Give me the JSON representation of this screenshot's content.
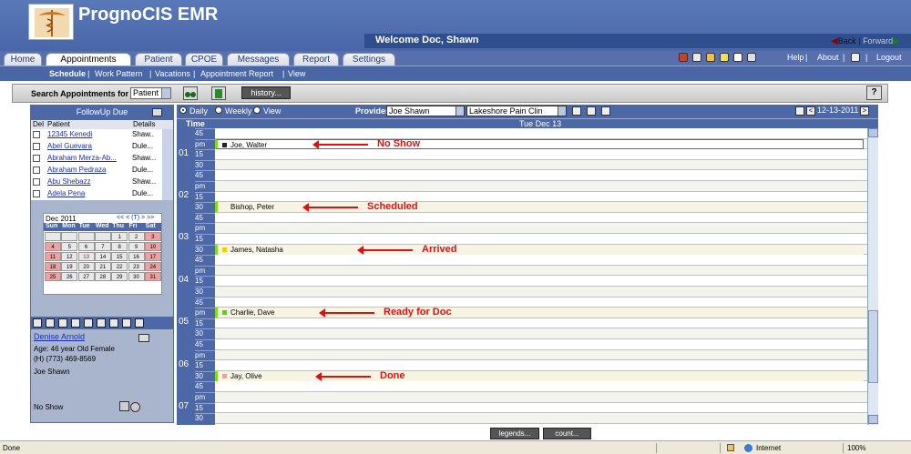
{
  "app": {
    "title": "PrognoCIS EMR",
    "welcome": "Welcome Doc, Shawn",
    "back": "Back",
    "forward": "Forward"
  },
  "tabs": [
    "Home",
    "Appointments",
    "Patient",
    "CPOE",
    "Messages",
    "Report",
    "Settings"
  ],
  "top_links": [
    "Help",
    "About",
    "Logout"
  ],
  "subnav": [
    "Schedule",
    "Work Pattern",
    "Vacations",
    "Appointment Report",
    "View"
  ],
  "search": {
    "label": "Search Appointments for",
    "type_value": "Patient",
    "history_label": "history...",
    "help_label": "?"
  },
  "followup": {
    "title": "FollowUp Due",
    "col_del": "Del",
    "col_patient": "Patient",
    "col_details": "Details",
    "rows": [
      {
        "name": "12345 Kenedi",
        "detail": "Shaw.."
      },
      {
        "name": "Abel Guevara",
        "detail": "Dule..."
      },
      {
        "name": "Abraham Merza-Ab...",
        "detail": "Shaw..."
      },
      {
        "name": "Abraham Pedraza",
        "detail": "Dule..."
      },
      {
        "name": "Abu Shebazz",
        "detail": "Shaw..."
      },
      {
        "name": "Adela Pena",
        "detail": "Dule..."
      }
    ]
  },
  "calendar": {
    "month": "Dec 2011",
    "nav": "<< < (T) > >>",
    "dow": [
      "Sun",
      "Mon",
      "Tue",
      "Wed",
      "Thu",
      "Fri",
      "Sat"
    ],
    "weeks": [
      [
        "",
        "",
        "",
        "",
        "1",
        "2",
        "3"
      ],
      [
        "4",
        "5",
        "6",
        "7",
        "8",
        "9",
        "10"
      ],
      [
        "11",
        "12",
        "13",
        "14",
        "15",
        "16",
        "17"
      ],
      [
        "18",
        "19",
        "20",
        "21",
        "22",
        "23",
        "24"
      ],
      [
        "25",
        "26",
        "27",
        "28",
        "29",
        "30",
        "31"
      ]
    ]
  },
  "patient": {
    "name": "Denise Arnold",
    "age": "Age: 46 year  Old Female",
    "phone": "(H) (773) 469-8569",
    "provider": "Joe Shawn",
    "status": "No Show"
  },
  "view": {
    "daily": "Daily",
    "weekly": "Weekly",
    "view": "View",
    "provider_label": "Provider",
    "provider_value": "Joe Shawn",
    "location_value": "Lakeshore Pain Clin",
    "date_value": "12-13-2011"
  },
  "schedule": {
    "time_header": "Time",
    "day_header": "Tue Dec 13",
    "slots": [
      {
        "hour": "",
        "min": "45"
      },
      {
        "hour": "01",
        "min": "pm"
      },
      {
        "hour": "",
        "min": "15"
      },
      {
        "hour": "",
        "min": "30"
      },
      {
        "hour": "",
        "min": "45"
      },
      {
        "hour": "02",
        "min": "pm"
      },
      {
        "hour": "",
        "min": "15"
      },
      {
        "hour": "",
        "min": "30"
      },
      {
        "hour": "",
        "min": "45"
      },
      {
        "hour": "03",
        "min": "pm"
      },
      {
        "hour": "",
        "min": "15"
      },
      {
        "hour": "",
        "min": "30"
      },
      {
        "hour": "",
        "min": "45"
      },
      {
        "hour": "04",
        "min": "pm"
      },
      {
        "hour": "",
        "min": "15"
      },
      {
        "hour": "",
        "min": "30"
      },
      {
        "hour": "",
        "min": "45"
      },
      {
        "hour": "05",
        "min": "pm"
      },
      {
        "hour": "",
        "min": "15"
      },
      {
        "hour": "",
        "min": "30"
      },
      {
        "hour": "",
        "min": "45"
      },
      {
        "hour": "06",
        "min": "pm"
      },
      {
        "hour": "",
        "min": "15"
      },
      {
        "hour": "",
        "min": "30"
      },
      {
        "hour": "",
        "min": "45"
      },
      {
        "hour": "07",
        "min": "pm"
      },
      {
        "hour": "",
        "min": "15"
      },
      {
        "hour": "",
        "min": "30"
      }
    ],
    "appointments": [
      {
        "name": "Joe, Walter",
        "status": "No Show",
        "color": "#222222"
      },
      {
        "name": "Bishop, Peter",
        "status": "Scheduled",
        "color": ""
      },
      {
        "name": "James, Natasha",
        "status": "Arrived",
        "color": "#f0d000"
      },
      {
        "name": "Charlie, Dave",
        "status": "Ready for Doc",
        "color": "#5fcc20"
      },
      {
        "name": "Jay, Olive",
        "status": "Done",
        "color": "#f0a0a0"
      }
    ]
  },
  "footer": {
    "legends": "legends...",
    "count": "count..."
  },
  "statusbar": {
    "left": "Done",
    "zone": "Internet",
    "zoom": "100%"
  }
}
